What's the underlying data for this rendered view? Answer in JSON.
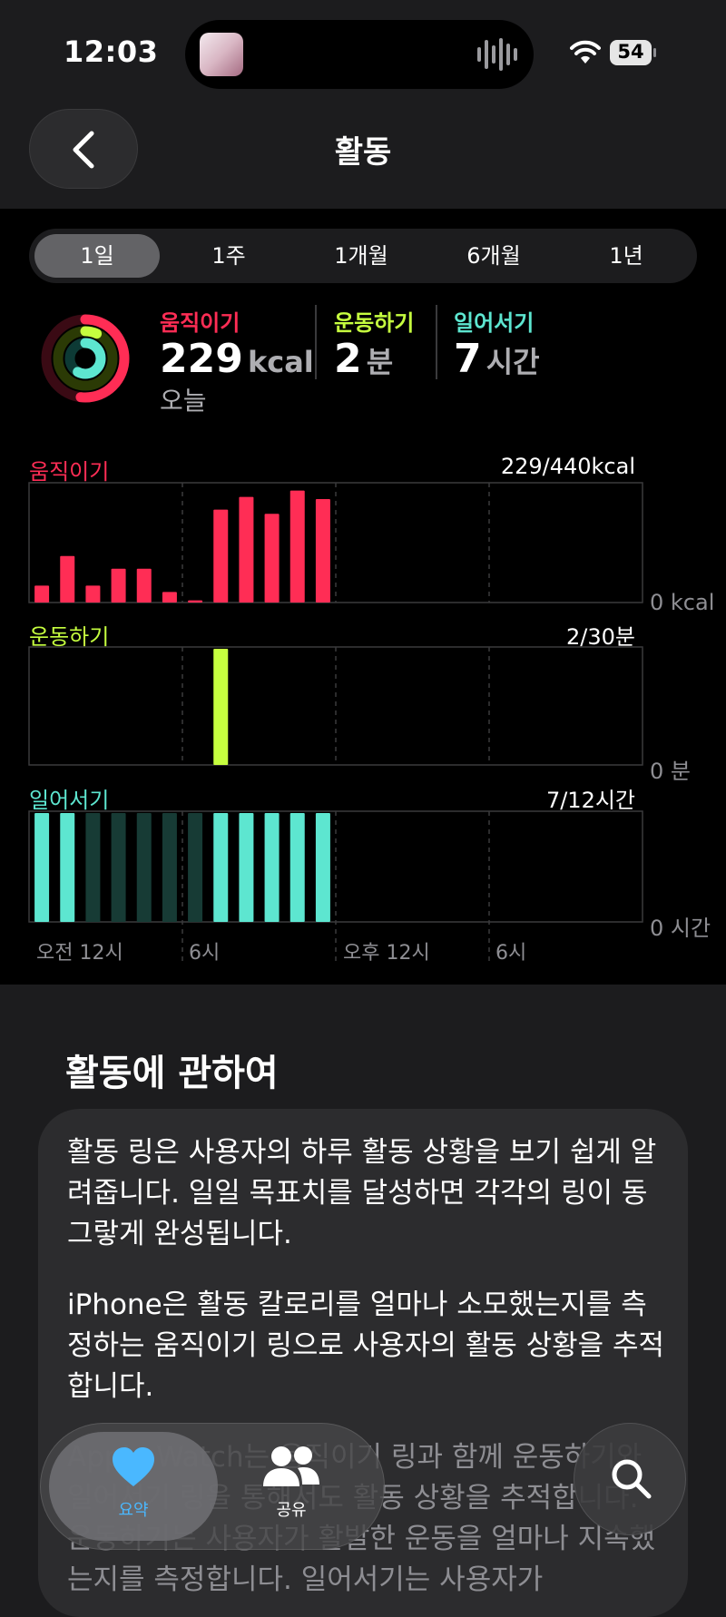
{
  "status_bar": {
    "time": "12:03",
    "battery": "54"
  },
  "nav": {
    "title": "활동"
  },
  "segments": [
    "1일",
    "1주",
    "1개월",
    "6개월",
    "1년"
  ],
  "summary": {
    "move": {
      "label": "움직이기",
      "value": "229",
      "unit": "kcal",
      "sub": "오늘"
    },
    "exercise": {
      "label": "운동하기",
      "value": "2",
      "unit": "분"
    },
    "stand": {
      "label": "일어서기",
      "value": "7",
      "unit": "시간"
    }
  },
  "charts": {
    "move": {
      "label": "움직이기",
      "total": "229/440kcal",
      "axis": "0 kcal"
    },
    "exercise": {
      "label": "운동하기",
      "total": "2/30분",
      "axis": "0 분"
    },
    "stand": {
      "label": "일어서기",
      "total": "7/12시간",
      "axis": "0 시간"
    },
    "xticks": [
      "오전 12시",
      "6시",
      "오후 12시",
      "6시"
    ]
  },
  "chart_data": [
    {
      "type": "bar",
      "title": "움직이기",
      "unit": "kcal",
      "hours": [
        0,
        1,
        2,
        3,
        4,
        5,
        6,
        7,
        8,
        9,
        10,
        11
      ],
      "values": [
        8,
        22,
        8,
        16,
        16,
        5,
        1,
        44,
        50,
        42,
        53,
        49
      ],
      "ylim": [
        0,
        55
      ],
      "color": "#ff2d55"
    },
    {
      "type": "bar",
      "title": "운동하기",
      "unit": "분",
      "hours": [
        7
      ],
      "values": [
        2
      ],
      "ylim": [
        0,
        2
      ],
      "color": "#c6ff3f"
    },
    {
      "type": "bar",
      "title": "일어서기",
      "hours": [
        0,
        1,
        2,
        3,
        4,
        5,
        6,
        7,
        8,
        9,
        10,
        11
      ],
      "values": [
        1,
        1,
        0,
        0,
        0,
        0,
        0,
        1,
        1,
        1,
        1,
        1
      ],
      "color_on": "#5de6d0",
      "color_off": "#173b35"
    }
  ],
  "about": {
    "title": "활동에 관하여",
    "p1": "활동 링은 사용자의 하루 활동 상황을 보기 쉽게 알려줍니다. 일일 목표치를 달성하면 각각의 링이 동그랗게 완성됩니다.",
    "p2": "iPhone은 활동 칼로리를 얼마나 소모했는지를 측정하는 움직이기 링으로 사용자의 활동 상황을 추적합니다.",
    "p3": "Apple Watch는 움직이기 링과 함께 운동하기와 일어서기 링을 통해서도 활동 상황을 추적합니다. 운동하기는 사용자가 활발한 운동을 얼마나 지속했는지를 측정합니다. 일어서기는 사용자가"
  },
  "tabbar": {
    "summary_label": "요약",
    "sharing_label": "공유"
  },
  "colors": {
    "move": "#ff2d55",
    "exercise": "#c6ff3f",
    "stand": "#5de6d0",
    "tab_active": "#4ab8ff"
  }
}
